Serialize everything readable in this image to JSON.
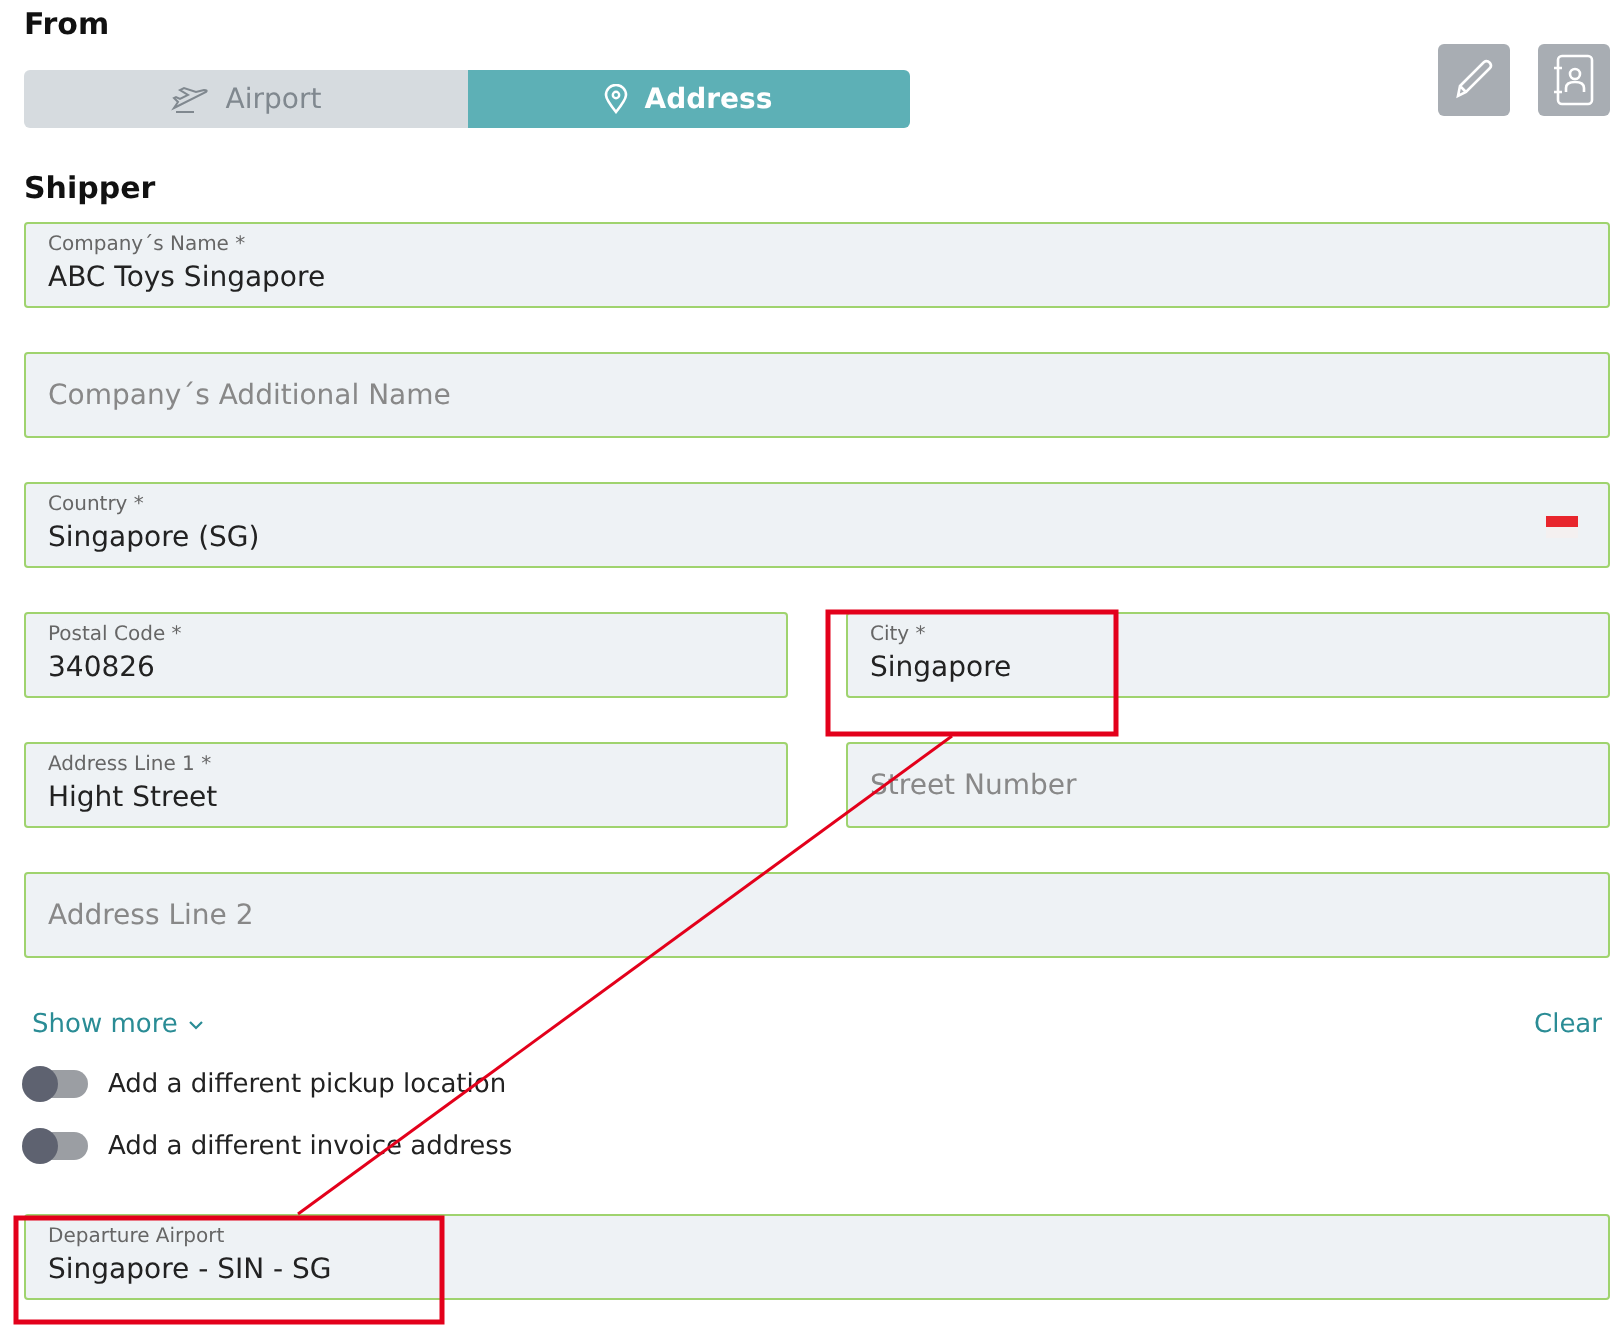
{
  "section_title": "From",
  "modes": [
    {
      "label": "Airport",
      "selected": false
    },
    {
      "label": "Address",
      "selected": true
    }
  ],
  "subtitle": "Shipper",
  "field_rows": [
    [
      {
        "kind": "filled",
        "label": "Company´s Name *",
        "value": "ABC Toys Singapore"
      }
    ],
    [
      {
        "kind": "empty",
        "placeholder": "Company´s Additional Name"
      }
    ],
    [
      {
        "kind": "country",
        "label": "Country *",
        "value": "Singapore (SG)"
      }
    ],
    [
      {
        "kind": "filled",
        "label": "Postal Code *",
        "value": "340826"
      },
      {
        "kind": "filled",
        "label": "City *",
        "value": "Singapore"
      }
    ],
    [
      {
        "kind": "filled",
        "label": "Address Line 1 *",
        "value": "Hight Street"
      },
      {
        "kind": "empty",
        "placeholder": "Street Number"
      }
    ],
    [
      {
        "kind": "empty",
        "placeholder": "Address Line 2"
      }
    ]
  ],
  "show_more": "Show more",
  "clear": "Clear",
  "toggles": [
    {
      "label": "Add a different pickup location",
      "on": false
    },
    {
      "label": "Add a different invoice address",
      "on": false
    }
  ],
  "departure": {
    "kind": "filled",
    "label": "Departure Airport",
    "value": "Singapore - SIN - SG"
  }
}
